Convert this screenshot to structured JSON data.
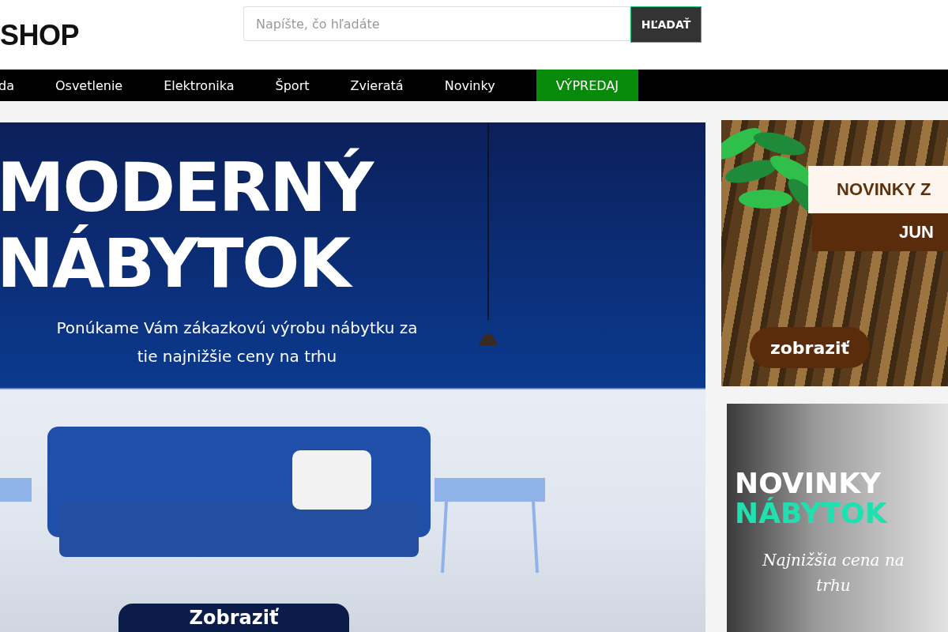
{
  "header": {
    "logo": "SHOP",
    "search": {
      "placeholder": "Napíšte, čo hľadáte",
      "button": "HĽADAŤ"
    }
  },
  "nav": [
    {
      "label": "da",
      "kind": "normal"
    },
    {
      "label": "Osvetlenie",
      "kind": "normal"
    },
    {
      "label": "Elektronika",
      "kind": "normal"
    },
    {
      "label": "Šport",
      "kind": "normal"
    },
    {
      "label": "Zvieratá",
      "kind": "normal"
    },
    {
      "label": "Novinky",
      "kind": "normal"
    },
    {
      "label": "VÝPREDAJ",
      "kind": "sale"
    }
  ],
  "hero": {
    "title_lines": [
      "MODERNÝ",
      "NÁBYTOK"
    ],
    "subtitle_lines": [
      "Ponúkame Vám zákazkovú výrobu nábytku za",
      "tie najnižšie ceny na trhu"
    ],
    "button": "Zobraziť"
  },
  "side_banners": [
    {
      "kind": "bark",
      "ribbon_top": "NOVINKY Z",
      "ribbon_bottom": "JUN",
      "button": "zobraziť"
    },
    {
      "kind": "room",
      "title": "NOVINKY",
      "subtitle": "NÁBYTOK",
      "tagline_lines": [
        "Najnižšia cena na",
        "trhu"
      ]
    }
  ]
}
